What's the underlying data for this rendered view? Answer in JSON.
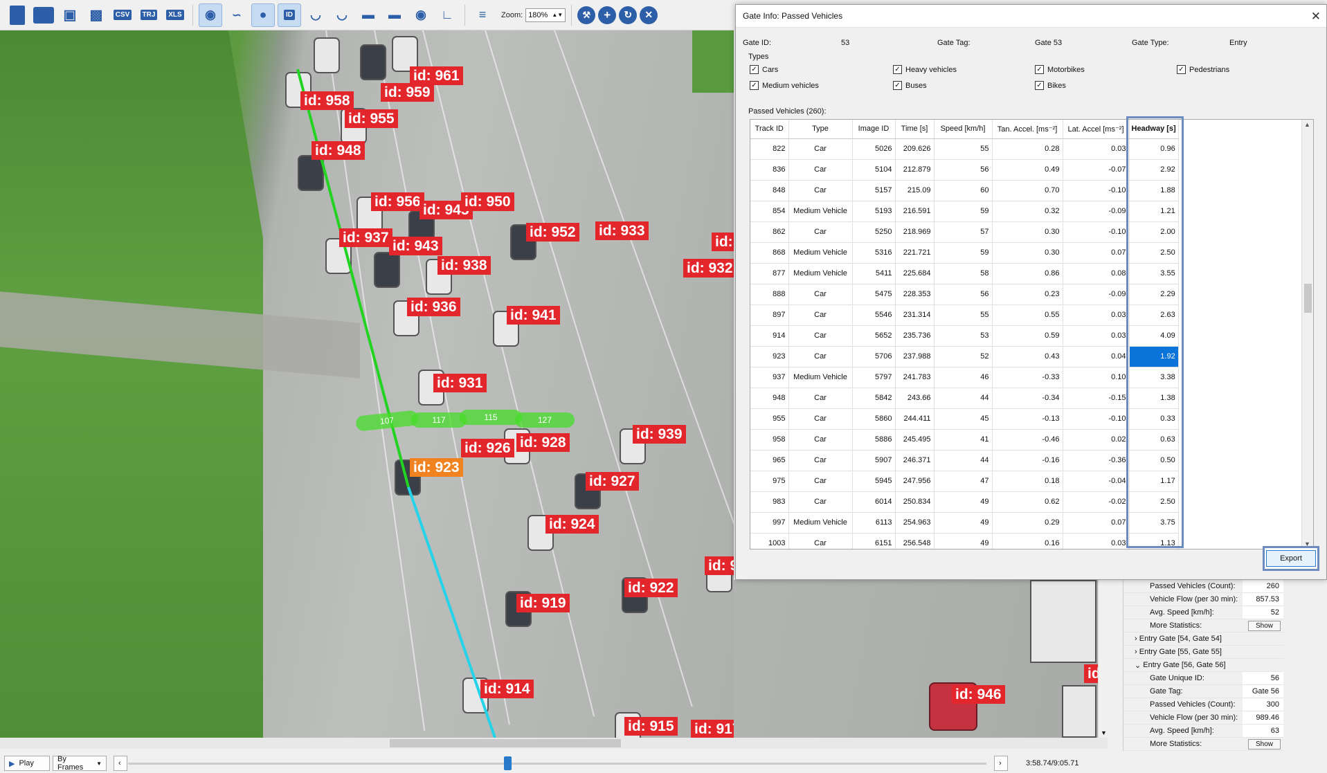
{
  "toolbar": {
    "file_buttons": [
      "CSV",
      "TRJ",
      "XLS"
    ],
    "id_tool": "ID",
    "zoom_label": "Zoom:",
    "zoom_value": "180%"
  },
  "video": {
    "labels": [
      {
        "text": "id: 961",
        "color": "red"
      },
      {
        "text": "id: 958",
        "color": "red"
      },
      {
        "text": "id: 959",
        "color": "red"
      },
      {
        "text": "id: 955",
        "color": "red"
      },
      {
        "text": "id: 948",
        "color": "red"
      },
      {
        "text": "id: 956",
        "color": "red"
      },
      {
        "text": "id: 945",
        "color": "red"
      },
      {
        "text": "id: 950",
        "color": "red"
      },
      {
        "text": "id: 937",
        "color": "red"
      },
      {
        "text": "id: 943",
        "color": "red"
      },
      {
        "text": "id: 952",
        "color": "red"
      },
      {
        "text": "id: 933",
        "color": "red"
      },
      {
        "text": "id: 932",
        "color": "red"
      },
      {
        "text": "id: 938",
        "color": "red"
      },
      {
        "text": "id: 936",
        "color": "red"
      },
      {
        "text": "id: 941",
        "color": "red"
      },
      {
        "text": "id: 931",
        "color": "red"
      },
      {
        "text": "id: 926",
        "color": "red"
      },
      {
        "text": "id: 928",
        "color": "red"
      },
      {
        "text": "id: 939",
        "color": "red"
      },
      {
        "text": "id: 923",
        "color": "orange"
      },
      {
        "text": "id: 927",
        "color": "red"
      },
      {
        "text": "id: 924",
        "color": "red"
      },
      {
        "text": "id: 922",
        "color": "red"
      },
      {
        "text": "id: 919",
        "color": "red"
      },
      {
        "text": "id: 914",
        "color": "red"
      },
      {
        "text": "id: 946",
        "color": "red"
      },
      {
        "text": "id: 915",
        "color": "red"
      },
      {
        "text": "id: 917",
        "color": "red"
      },
      {
        "text": "id:",
        "color": "red"
      },
      {
        "text": "id: 9",
        "color": "red"
      }
    ],
    "gate_segments": [
      "107",
      "117",
      "115",
      "127"
    ]
  },
  "playback": {
    "play_label": "Play",
    "mode_label": "By Frames",
    "time": "3:58.74/9:05.71"
  },
  "side_panel": {
    "rows": [
      {
        "key": "Passed Vehicles (Count):",
        "value": "260"
      },
      {
        "key": "Vehicle Flow (per 30 min):",
        "value": "857.53"
      },
      {
        "key": "Avg. Speed [km/h]:",
        "value": "52"
      },
      {
        "key": "More Statistics:",
        "value": "Show"
      }
    ],
    "groups": [
      {
        "label": "Entry Gate [54, Gate 54]",
        "expanded": false
      },
      {
        "label": "Entry Gate [55, Gate 55]",
        "expanded": false
      },
      {
        "label": "Entry Gate [56, Gate 56]",
        "expanded": true
      }
    ],
    "gate56_rows": [
      {
        "key": "Gate Unique ID:",
        "value": "56"
      },
      {
        "key": "Gate Tag:",
        "value": "Gate 56"
      },
      {
        "key": "Passed Vehicles (Count):",
        "value": "300"
      },
      {
        "key": "Vehicle Flow (per 30 min):",
        "value": "989.46"
      },
      {
        "key": "Avg. Speed [km/h]:",
        "value": "63"
      },
      {
        "key": "More Statistics:",
        "value": "Show"
      }
    ]
  },
  "dialog": {
    "title": "Gate Info: Passed Vehicles",
    "gate_id_label": "Gate ID:",
    "gate_id": "53",
    "gate_tag_label": "Gate Tag:",
    "gate_tag": "Gate 53",
    "gate_type_label": "Gate Type:",
    "gate_type": "Entry",
    "types_label": "Types",
    "types": [
      {
        "label": "Cars",
        "checked": true
      },
      {
        "label": "Heavy vehicles",
        "checked": true
      },
      {
        "label": "Motorbikes",
        "checked": true
      },
      {
        "label": "Pedestrians",
        "checked": true
      },
      {
        "label": "Medium vehicles",
        "checked": true
      },
      {
        "label": "Buses",
        "checked": true
      },
      {
        "label": "Bikes",
        "checked": true
      }
    ],
    "passed_label": "Passed Vehicles (260):",
    "export_label": "Export",
    "table": {
      "headers": [
        "Track ID",
        "Type",
        "Image ID",
        "Time [s]",
        "Speed [km/h]",
        "Tan. Accel. [ms⁻²]",
        "Lat. Accel [ms⁻²]",
        "Headway [s]"
      ],
      "rows": [
        [
          "822",
          "Car",
          "5026",
          "209.626",
          "55",
          "0.28",
          "0.03",
          "0.96"
        ],
        [
          "836",
          "Car",
          "5104",
          "212.879",
          "56",
          "0.49",
          "-0.07",
          "2.92"
        ],
        [
          "848",
          "Car",
          "5157",
          "215.09",
          "60",
          "0.70",
          "-0.10",
          "1.88"
        ],
        [
          "854",
          "Medium Vehicle",
          "5193",
          "216.591",
          "59",
          "0.32",
          "-0.09",
          "1.21"
        ],
        [
          "862",
          "Car",
          "5250",
          "218.969",
          "57",
          "0.30",
          "-0.10",
          "2.00"
        ],
        [
          "868",
          "Medium Vehicle",
          "5316",
          "221.721",
          "59",
          "0.30",
          "0.07",
          "2.50"
        ],
        [
          "877",
          "Medium Vehicle",
          "5411",
          "225.684",
          "58",
          "0.86",
          "0.08",
          "3.55"
        ],
        [
          "888",
          "Car",
          "5475",
          "228.353",
          "56",
          "0.23",
          "-0.09",
          "2.29"
        ],
        [
          "897",
          "Car",
          "5546",
          "231.314",
          "55",
          "0.55",
          "0.03",
          "2.63"
        ],
        [
          "914",
          "Car",
          "5652",
          "235.736",
          "53",
          "0.59",
          "0.03",
          "4.09"
        ],
        [
          "923",
          "Car",
          "5706",
          "237.988",
          "52",
          "0.43",
          "0.04",
          "1.92"
        ],
        [
          "937",
          "Medium Vehicle",
          "5797",
          "241.783",
          "46",
          "-0.33",
          "0.10",
          "3.38"
        ],
        [
          "948",
          "Car",
          "5842",
          "243.66",
          "44",
          "-0.34",
          "-0.15",
          "1.38"
        ],
        [
          "955",
          "Car",
          "5860",
          "244.411",
          "45",
          "-0.13",
          "-0.10",
          "0.33"
        ],
        [
          "958",
          "Car",
          "5886",
          "245.495",
          "41",
          "-0.46",
          "0.02",
          "0.63"
        ],
        [
          "965",
          "Car",
          "5907",
          "246.371",
          "44",
          "-0.16",
          "-0.36",
          "0.50"
        ],
        [
          "975",
          "Car",
          "5945",
          "247.956",
          "47",
          "0.18",
          "-0.04",
          "1.17"
        ],
        [
          "983",
          "Car",
          "6014",
          "250.834",
          "49",
          "0.62",
          "-0.02",
          "2.50"
        ],
        [
          "997",
          "Medium Vehicle",
          "6113",
          "254.963",
          "49",
          "0.29",
          "0.07",
          "3.75"
        ],
        [
          "1003",
          "Car",
          "6151",
          "256.548",
          "49",
          "0.16",
          "0.03",
          "1.13"
        ]
      ],
      "selected_row": 10
    }
  }
}
